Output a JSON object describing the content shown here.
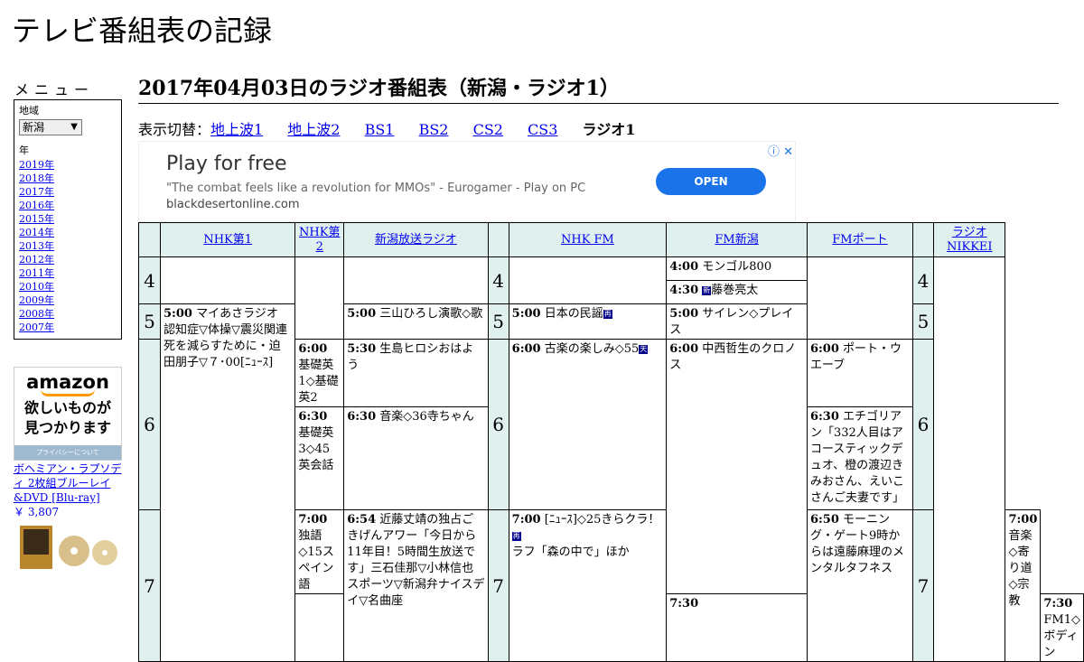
{
  "site": {
    "title": "テレビ番組表の記録"
  },
  "menu": {
    "heading": "メニュー",
    "region_label": "地域",
    "region_value": "新潟",
    "year_label": "年",
    "years": [
      "2019年",
      "2018年",
      "2017年",
      "2016年",
      "2015年",
      "2014年",
      "2013年",
      "2012年",
      "2011年",
      "2010年",
      "2009年",
      "2008年",
      "2007年"
    ]
  },
  "amazon": {
    "logo": "amazon",
    "copy_line1": "欲しいものが",
    "copy_line2": "見つかります",
    "privacy": "プライバシーについて",
    "product": "ボヘミアン・ラプソディ 2枚組ブルーレイ&DVD [Blu-ray]",
    "price": "￥ 3,807"
  },
  "page": {
    "title": "2017年04月03日のラジオ番組表（新潟・ラジオ1）"
  },
  "switcher": {
    "prefix": "表示切替：",
    "links": [
      "地上波1",
      "地上波2",
      "BS1",
      "BS2",
      "CS2",
      "CS3"
    ],
    "current": "ラジオ1"
  },
  "ad": {
    "headline": "Play for free",
    "sub": "\"The combat feels like a revolution for MMOs\" - Eurogamer - Play on PC",
    "url": "blackdesertonline.com",
    "cta": "OPEN",
    "info_icon": "ⓘ",
    "close_icon": "✕"
  },
  "schedule": {
    "stations": [
      "NHK第1",
      "NHK第2",
      "新潟放送ラジオ",
      "NHK FM",
      "FM新潟",
      "FMポート",
      "ラジオNIKKEI"
    ],
    "hours": [
      "4",
      "5",
      "6",
      "7"
    ],
    "programs": {
      "nhk1_0500_time": "5:00",
      "nhk1_0500_title": "マイあさラジオ　認知症▽体操▽震災関連死を減らすために・迫田朋子▽７･00[ﾆｭｰｽ]",
      "nhk2_0600_time": "6:00",
      "nhk2_0600_title": "基礎英1◇基礎英2",
      "nhk2_0630_time": "6:30",
      "nhk2_0630_title": "基礎英3◇45英会話",
      "nhk2_0700_time": "7:00",
      "nhk2_0700_title": "独語◇15スペイン語",
      "nhk2_0730_time": "7:30",
      "bsn_0500_time": "5:00",
      "bsn_0500_title": "三山ひろし演歌◇歌",
      "bsn_0530_time": "5:30",
      "bsn_0530_title": "生島ヒロシおはよう",
      "bsn_0630_time": "6:30",
      "bsn_0630_title": "音楽◇36寺ちゃん",
      "bsn_0654_time": "6:54",
      "bsn_0654_title": "近藤丈靖の独占ごきげんアワー「今日から11年目！5時間生放送です」三石佳那▽小林信也スポーツ▽新潟弁ナイスデイ▽名曲座",
      "fm_0500_time": "5:00",
      "fm_0500_title": "日本の民謡",
      "fm_0500_badge": "再",
      "fm_0600_time": "6:00",
      "fm_0600_title": "古楽の楽しみ◇55",
      "fm_0600_badge": "天",
      "fm_0700_time": "7:00",
      "fm_0700_title": "[ﾆｭｰｽ]◇25きらクラ！",
      "fm_0700_badge": "再",
      "fm_0700_title2": "ラフ「森の中で」ほか",
      "fmn_0400_time": "4:00",
      "fmn_0400_title": "モンゴル800",
      "fmn_0430_time": "4:30",
      "fmn_0430_title": "藤巻亮太",
      "fmn_0430_badge": "新",
      "fmn_0500_time": "5:00",
      "fmn_0500_title": "サイレン◇プレイス",
      "fmn_0600_time": "6:00",
      "fmn_0600_title": "中西哲生のクロノス",
      "fmn_0730_time": "7:30",
      "fmn_0730_title": "FM1◇ボディン",
      "fmp_0600_time": "6:00",
      "fmp_0600_title": "ポート・ウエーブ",
      "fmp_0630_time": "6:30",
      "fmp_0630_title": "エチゴリアン「332人目はアコースティックデュオ、橙の渡辺きみおさん、えいこさんご夫妻です」",
      "fmp_0650_time": "6:50",
      "fmp_0650_title": "モーニング・ゲート9時からは遠藤麻理のメンタルタフネス",
      "nikkei_0700_time": "7:00",
      "nikkei_0700_title": "音楽◇寄り道◇宗教"
    }
  }
}
